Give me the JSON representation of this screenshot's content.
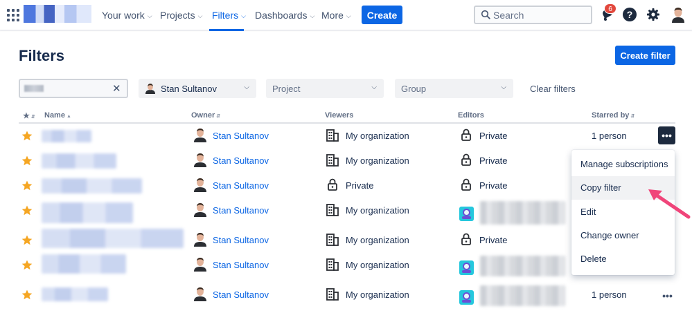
{
  "nav": {
    "items": [
      {
        "label": "Your work"
      },
      {
        "label": "Projects"
      },
      {
        "label": "Filters"
      },
      {
        "label": "Dashboards"
      },
      {
        "label": "More"
      }
    ],
    "create_label": "Create",
    "search_placeholder": "Search",
    "notification_count": "6",
    "help_label": "?"
  },
  "header": {
    "title": "Filters",
    "create_filter_label": "Create filter"
  },
  "filters": {
    "owner_value": "Stan Sultanov",
    "project_placeholder": "Project",
    "group_placeholder": "Group",
    "clear_label": "Clear filters"
  },
  "table": {
    "columns": [
      "Name",
      "Owner",
      "Viewers",
      "Editors",
      "Starred by"
    ],
    "rows": [
      {
        "owner": "Stan Sultanov",
        "viewers": "My organization",
        "editors": "Private",
        "starred_by": "1 person"
      },
      {
        "owner": "Stan Sultanov",
        "viewers": "My organization",
        "editors": "Private",
        "starred_by": ""
      },
      {
        "owner": "Stan Sultanov",
        "viewers": "Private",
        "editors": "Private",
        "starred_by": ""
      },
      {
        "owner": "Stan Sultanov",
        "viewers": "My organization",
        "editors": "",
        "starred_by": ""
      },
      {
        "owner": "Stan Sultanov",
        "viewers": "My organization",
        "editors": "Private",
        "starred_by": ""
      },
      {
        "owner": "Stan Sultanov",
        "viewers": "My organization",
        "editors": "",
        "starred_by": ""
      },
      {
        "owner": "Stan Sultanov",
        "viewers": "My organization",
        "editors": "",
        "starred_by": "1 person"
      }
    ]
  },
  "menu": {
    "items": [
      "Manage subscriptions",
      "Copy filter",
      "Edit",
      "Change owner",
      "Delete"
    ]
  },
  "colors": {
    "accent": "#0c66e4",
    "star": "#f5a623",
    "annotation_arrow": "#f0457a"
  }
}
